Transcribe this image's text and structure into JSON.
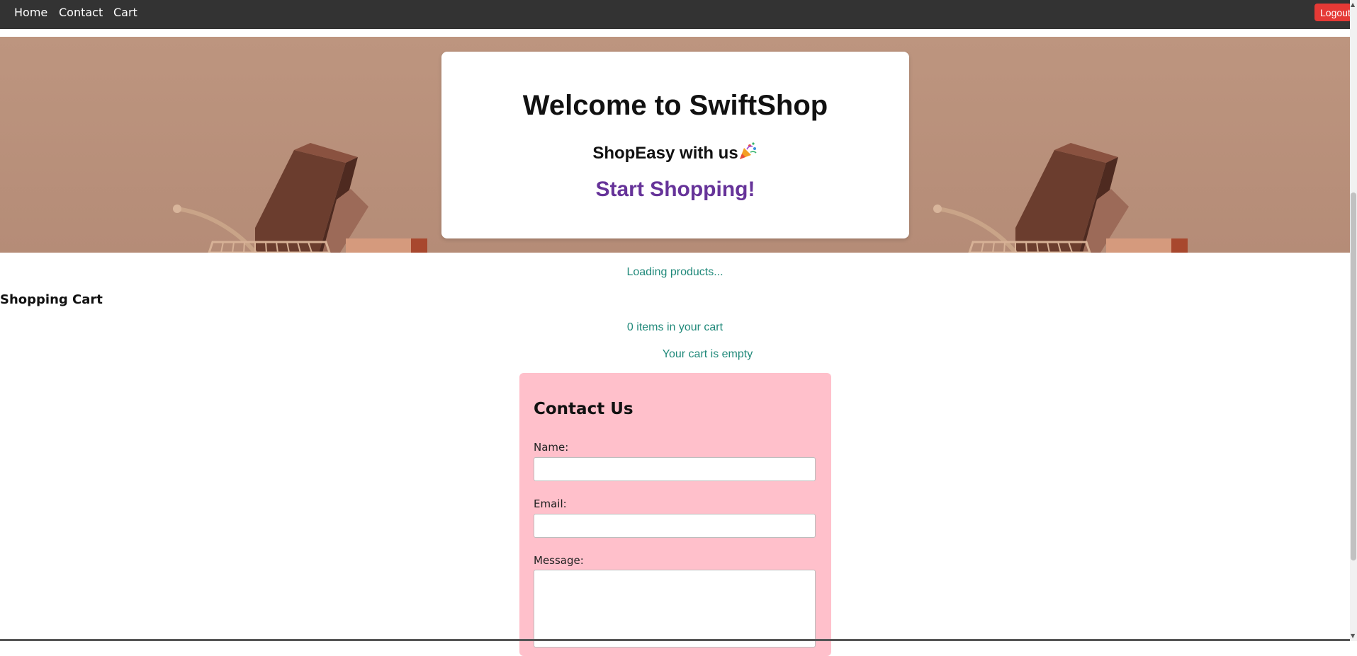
{
  "nav": {
    "links": [
      "Home",
      "Contact",
      "Cart"
    ],
    "logout_label": "Logout"
  },
  "hero": {
    "title": "Welcome to SwiftShop",
    "subtitle": "ShopEasy with us",
    "cta": "Start Shopping!"
  },
  "status": {
    "loading": "Loading products..."
  },
  "cart": {
    "heading": "Shopping Cart",
    "count_text": "0 items in your cart",
    "empty_text": "Your cart is empty"
  },
  "contact": {
    "title": "Contact Us",
    "name_label": "Name:",
    "email_label": "Email:",
    "message_label": "Message:"
  },
  "colors": {
    "nav_bg": "#333333",
    "logout_bg": "#e53935",
    "cta": "#663399",
    "status_text": "#20897a",
    "contact_bg": "#ffc0cb"
  },
  "icons": {
    "subtitle_emoji": "party-popper-icon"
  }
}
